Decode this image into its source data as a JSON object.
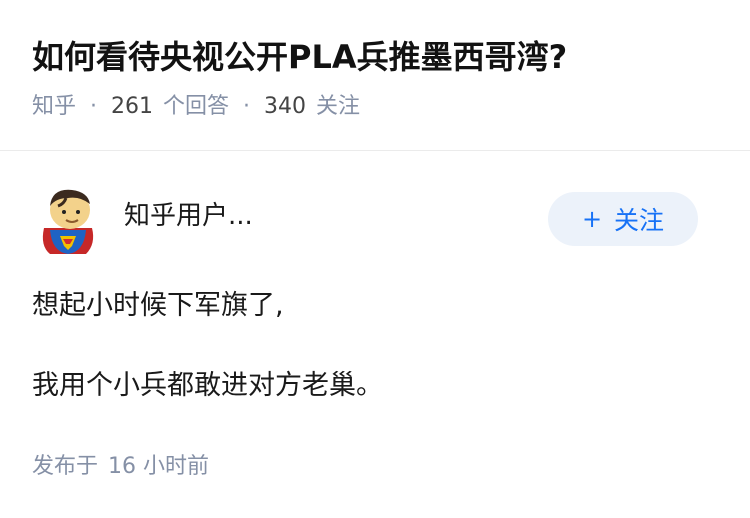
{
  "question": {
    "title": "如何看待央视公开PLA兵推墨西哥湾?",
    "source": "知乎",
    "answer_count": "261",
    "answer_label": "个回答",
    "follower_count": "340",
    "follower_label": "关注"
  },
  "answer": {
    "author_name": "知乎用户...",
    "avatar_icon": "superman-avatar-icon",
    "follow_button": {
      "plus": "+",
      "label": "关注"
    },
    "paragraphs": [
      "想起小时候下军旗了,",
      "我用个小兵都敢进对方老巢。"
    ],
    "published_label": "发布于",
    "published_time": "16 小时前"
  },
  "colors": {
    "meta_gray": "#8590a6",
    "accent_blue": "#1772f6",
    "follow_bg": "#ecf2fa"
  }
}
